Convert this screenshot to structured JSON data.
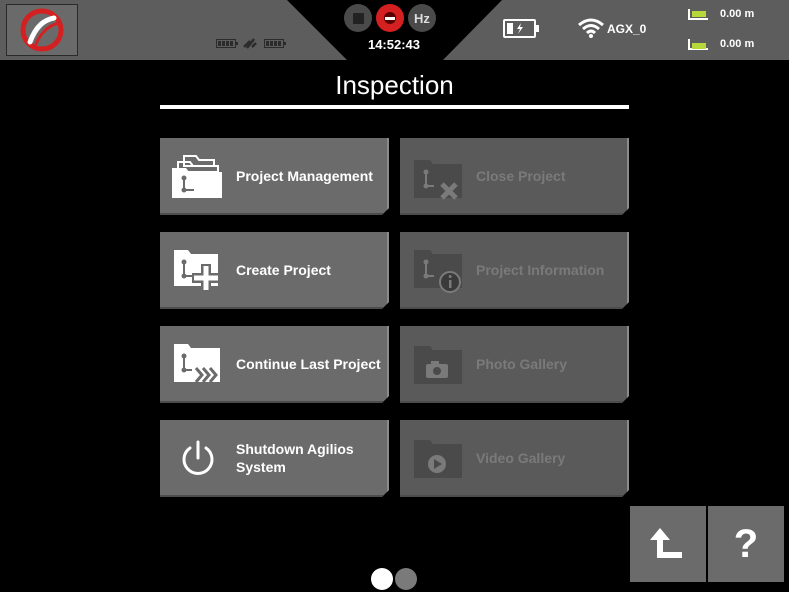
{
  "status_bar": {
    "time": "14:52:43",
    "hz_label": "Hz",
    "network_name": "AGX_0",
    "measurement_1": "0.00 m",
    "measurement_2": "0.00 m"
  },
  "page": {
    "title": "Inspection"
  },
  "menu": {
    "project_management": "Project Management",
    "close_project": "Close Project",
    "create_project": "Create Project",
    "project_information": "Project Information",
    "continue_last_project": "Continue Last Project",
    "photo_gallery": "Photo Gallery",
    "shutdown_line1": "Shutdown Agilios",
    "shutdown_line2": "System",
    "video_gallery": "Video Gallery"
  },
  "footer": {
    "help_label": "?"
  },
  "colors": {
    "accent_red": "#d42020",
    "level_green": "#b6d83a",
    "tile_bg": "#6b6b6b",
    "tile_disabled_bg": "#5a5a5a",
    "disabled_text": "#7a7a7a"
  }
}
